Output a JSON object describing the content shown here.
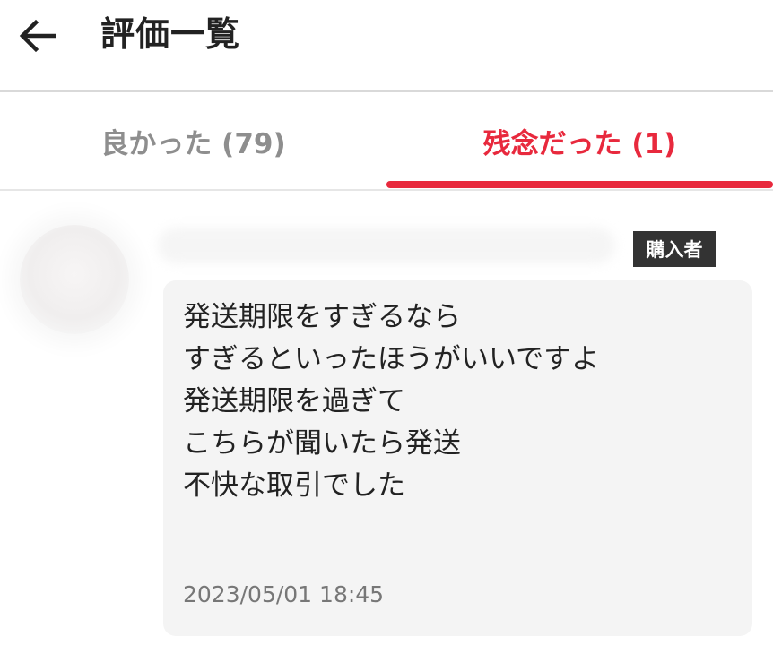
{
  "header": {
    "back_icon": "arrow-left-icon",
    "title": "評価一覧"
  },
  "tabs": [
    {
      "label": "良かった (79)",
      "active": false
    },
    {
      "label": "残念だった (1)",
      "active": true
    }
  ],
  "colors": {
    "accent": "#e8293d",
    "inactive_tab": "#8e8e8e",
    "badge_bg": "#333333",
    "bubble_bg": "#f4f4f4"
  },
  "review": {
    "badge": "購入者",
    "lines": [
      "発送期限をすぎるなら",
      "すぎるといったほうがいいですよ",
      "発送期限を過ぎて",
      "こちらが聞いたら発送",
      "不快な取引でした"
    ],
    "date": "2023/05/01 18:45"
  }
}
